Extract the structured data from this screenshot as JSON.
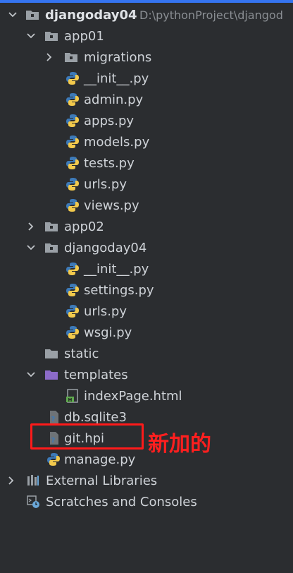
{
  "tree": {
    "project": {
      "name": "djangoday04",
      "path": "D:\\pythonProject\\djangod"
    },
    "items": [
      {
        "label": "app01"
      },
      {
        "label": "migrations"
      },
      {
        "label": "__init__.py"
      },
      {
        "label": "admin.py"
      },
      {
        "label": "apps.py"
      },
      {
        "label": "models.py"
      },
      {
        "label": "tests.py"
      },
      {
        "label": "urls.py"
      },
      {
        "label": "views.py"
      },
      {
        "label": "app02"
      },
      {
        "label": "djangoday04"
      },
      {
        "label": "__init__.py"
      },
      {
        "label": "settings.py"
      },
      {
        "label": "urls.py"
      },
      {
        "label": "wsgi.py"
      },
      {
        "label": "static"
      },
      {
        "label": "templates"
      },
      {
        "label": "indexPage.html"
      },
      {
        "label": "db.sqlite3"
      },
      {
        "label": "git.hpi"
      },
      {
        "label": "manage.py"
      },
      {
        "label": "External Libraries"
      },
      {
        "label": "Scratches and Consoles"
      }
    ]
  },
  "annotation": {
    "text": "新加的",
    "color": "#ff1f1f"
  },
  "colors": {
    "background": "#2b2d30",
    "folder": "#9aa0a6",
    "templates_folder": "#8c6bc8",
    "python_blue": "#3d7ab8",
    "python_yellow": "#f2c94c"
  }
}
